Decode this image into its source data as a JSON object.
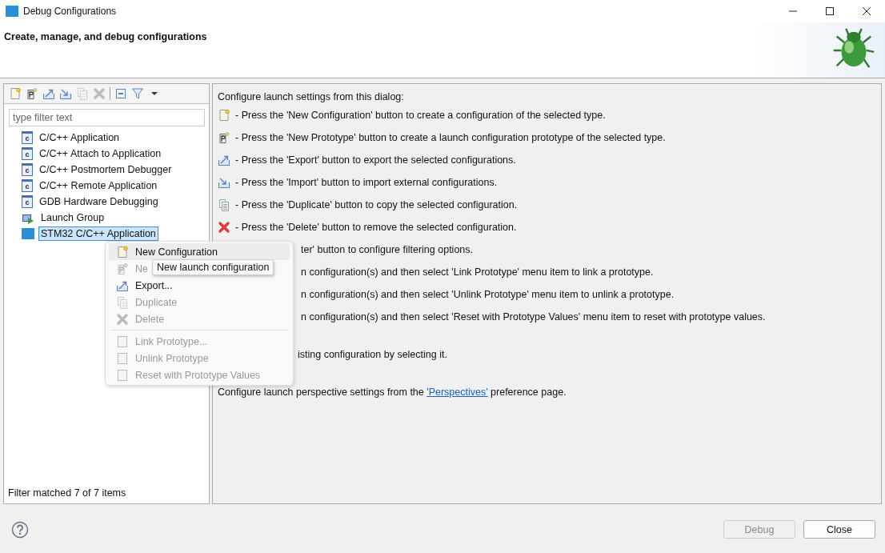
{
  "window": {
    "title": "Debug Configurations"
  },
  "header": {
    "title": "Create, manage, and debug configurations"
  },
  "filter": {
    "placeholder": "type filter text"
  },
  "tree": [
    {
      "label": "C/C++ Application",
      "kind": "c",
      "selected": false
    },
    {
      "label": "C/C++ Attach to Application",
      "kind": "c",
      "selected": false
    },
    {
      "label": "C/C++ Postmortem Debugger",
      "kind": "c",
      "selected": false
    },
    {
      "label": "C/C++ Remote Application",
      "kind": "c",
      "selected": false
    },
    {
      "label": "GDB Hardware Debugging",
      "kind": "c",
      "selected": false
    },
    {
      "label": "Launch Group",
      "kind": "launch",
      "selected": false
    },
    {
      "label": "STM32 C/C++ Application",
      "kind": "ide",
      "selected": true
    }
  ],
  "status": "Filter matched 7 of 7 items",
  "info": {
    "intro": "Configure launch settings from this dialog:",
    "lines": [
      {
        "kind": "new",
        "text": "- Press the 'New Configuration' button to create a configuration of the selected type."
      },
      {
        "kind": "prototype",
        "text": "- Press the 'New Prototype' button to create a launch configuration prototype of the selected type."
      },
      {
        "kind": "export",
        "text": "- Press the 'Export' button to export the selected configurations."
      },
      {
        "kind": "import",
        "text": "- Press the 'Import' button to import external configurations."
      },
      {
        "kind": "duplicate",
        "text": "- Press the 'Duplicate' button to copy the selected configuration."
      },
      {
        "kind": "delete",
        "text": "- Press the 'Delete' button to remove the selected configuration."
      },
      {
        "kind": "covered",
        "text": "ter' button to configure filtering options."
      },
      {
        "kind": "covered",
        "text": "n configuration(s) and then select 'Link Prototype' menu item to link a prototype."
      },
      {
        "kind": "covered",
        "text": "n configuration(s) and then select 'Unlink Prototype' menu item to unlink a prototype."
      },
      {
        "kind": "covered",
        "text": "n configuration(s) and then select 'Reset with Prototype Values' menu item to reset with prototype values."
      }
    ],
    "edit": "isting configuration by selecting it.",
    "closing": {
      "before": "Configure launch perspective settings from the",
      "link": "'Perspectives'",
      "after": "preference page."
    }
  },
  "menu": [
    {
      "kind": "item",
      "label": "New Configuration",
      "disabled": false,
      "selected": true
    },
    {
      "kind": "item",
      "label": "Ne",
      "disabled": true,
      "selected": false
    },
    {
      "kind": "item",
      "label": "Export...",
      "disabled": false,
      "selected": false
    },
    {
      "kind": "item",
      "label": "Duplicate",
      "disabled": true,
      "selected": false
    },
    {
      "kind": "item",
      "label": "Delete",
      "disabled": true,
      "selected": false
    },
    {
      "kind": "separator"
    },
    {
      "kind": "item",
      "label": "Link Prototype...",
      "disabled": true,
      "selected": false
    },
    {
      "kind": "item",
      "label": "Unlink Prototype",
      "disabled": true,
      "selected": false
    },
    {
      "kind": "item",
      "label": "Reset with Prototype Values",
      "disabled": true,
      "selected": false
    }
  ],
  "tooltip": "New launch configuration",
  "buttons": [
    {
      "label": "Debug",
      "disabled": true
    },
    {
      "label": "Close",
      "disabled": false
    }
  ]
}
